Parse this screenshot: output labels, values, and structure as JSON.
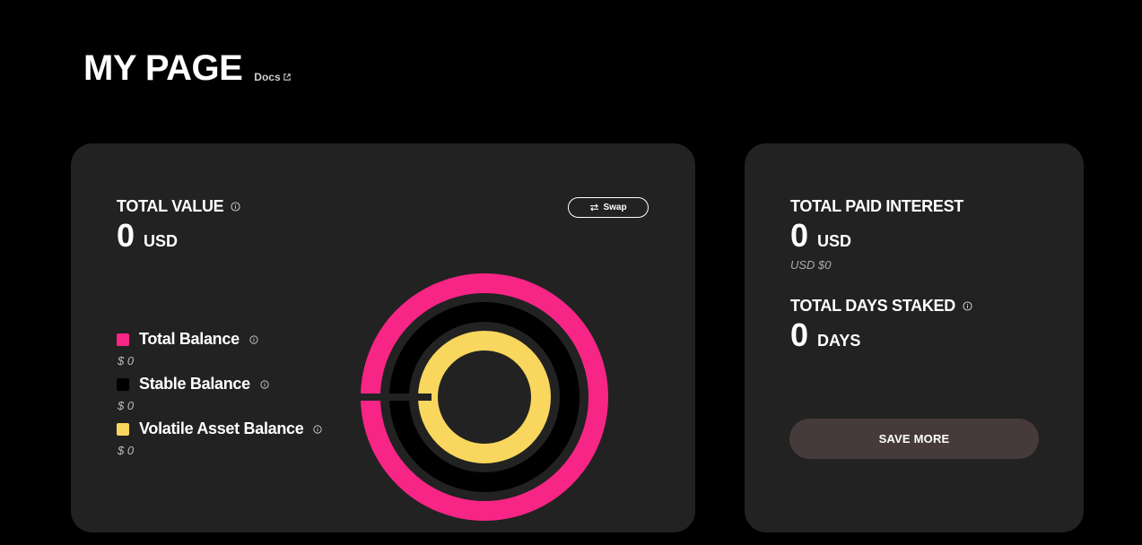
{
  "header": {
    "title": "MY PAGE",
    "docs_label": "Docs"
  },
  "total_value": {
    "label": "TOTAL VALUE",
    "amount": "0",
    "unit": "USD",
    "swap_label": "Swap"
  },
  "legend": [
    {
      "label": "Total Balance",
      "value": "$ 0",
      "color": "#f72585"
    },
    {
      "label": "Stable Balance",
      "value": "$ 0",
      "color": "#000000"
    },
    {
      "label": "Volatile Asset Balance",
      "value": "$ 0",
      "color": "#f9d65d"
    }
  ],
  "side": {
    "paid_interest": {
      "label": "TOTAL PAID INTEREST",
      "amount": "0",
      "unit": "USD",
      "sub": "USD $0"
    },
    "days_staked": {
      "label": "TOTAL DAYS STAKED",
      "amount": "0",
      "unit": "DAYS"
    },
    "save_label": "SAVE MORE"
  },
  "colors": {
    "accent_pink": "#f72585",
    "accent_yellow": "#f9d65d",
    "card_bg": "#222222",
    "button_bg": "#473a3a"
  }
}
